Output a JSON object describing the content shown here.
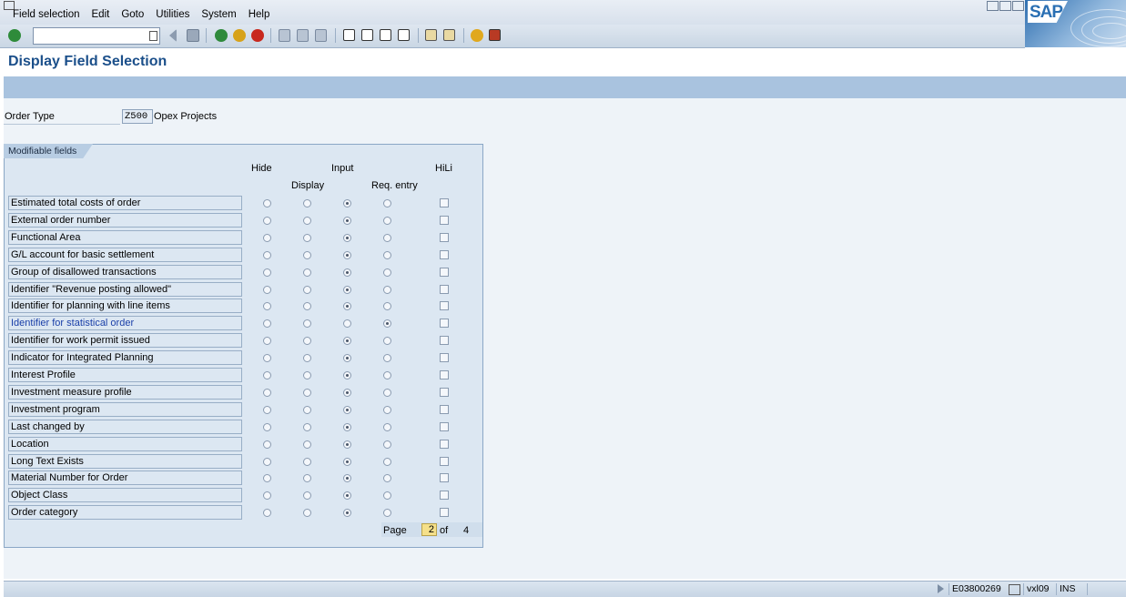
{
  "menu": [
    "Field selection",
    "Edit",
    "Goto",
    "Utilities",
    "System",
    "Help"
  ],
  "brand": "SAP",
  "title": "Display Field Selection",
  "order_type": {
    "label": "Order Type",
    "value": "Z500",
    "description": "Opex Projects"
  },
  "group": {
    "title": "Modifiable fields",
    "headers": {
      "hide": "Hide",
      "input": "Input",
      "hili": "HiLi",
      "display": "Display",
      "req_entry": "Req. entry"
    },
    "rows": [
      {
        "label": "Estimated total costs of order",
        "selected": "input",
        "hili": false
      },
      {
        "label": "External order number",
        "selected": "input",
        "hili": false
      },
      {
        "label": "Functional Area",
        "selected": "input",
        "hili": false
      },
      {
        "label": "G/L account for basic settlement",
        "selected": "input",
        "hili": false
      },
      {
        "label": "Group of disallowed transactions",
        "selected": "input",
        "hili": false
      },
      {
        "label": "Identifier \"Revenue posting allowed\"",
        "selected": "input",
        "hili": false
      },
      {
        "label": "Identifier for planning with line items",
        "selected": "input",
        "hili": false
      },
      {
        "label": "Identifier for statistical order",
        "selected": "req",
        "hili": false,
        "link": true
      },
      {
        "label": "Identifier for work permit issued",
        "selected": "input",
        "hili": false
      },
      {
        "label": "Indicator for Integrated Planning",
        "selected": "input",
        "hili": false
      },
      {
        "label": "Interest Profile",
        "selected": "input",
        "hili": false
      },
      {
        "label": "Investment measure profile",
        "selected": "input",
        "hili": false
      },
      {
        "label": "Investment program",
        "selected": "input",
        "hili": false
      },
      {
        "label": "Last changed by",
        "selected": "input",
        "hili": false
      },
      {
        "label": "Location",
        "selected": "input",
        "hili": false
      },
      {
        "label": "Long Text Exists",
        "selected": "input",
        "hili": false
      },
      {
        "label": "Material Number for Order",
        "selected": "input",
        "hili": false
      },
      {
        "label": "Object Class",
        "selected": "input",
        "hili": false
      },
      {
        "label": "Order category",
        "selected": "input",
        "hili": false
      }
    ]
  },
  "pager": {
    "label": "Page",
    "current": "2",
    "of": "of",
    "total": "4"
  },
  "status": {
    "session": "E03800269",
    "server": "vxl09",
    "mode": "INS"
  },
  "colors": {
    "title": "#1b4f8a",
    "app_toolbar": "#a9c3df",
    "group_bg": "#dce7f2",
    "link": "#1a3fa8",
    "page_highlight": "#f5e08a"
  }
}
